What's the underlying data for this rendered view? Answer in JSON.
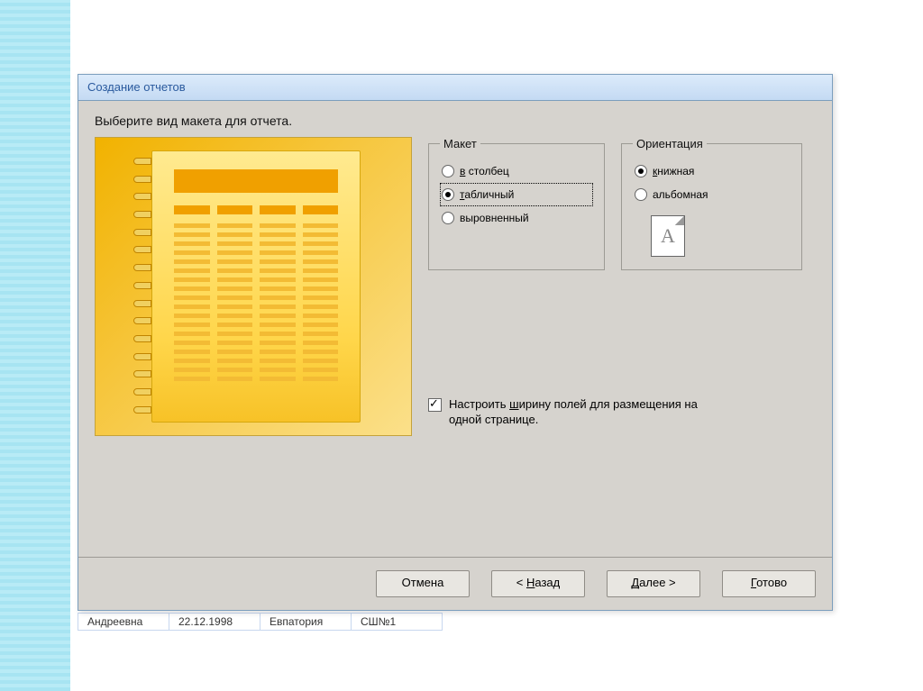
{
  "bg_cells": [
    "Андреевна",
    "22.12.1998",
    "Евпатория",
    "СШ№1"
  ],
  "dialog": {
    "title": "Создание отчетов",
    "instruction": "Выберите вид макета для отчета.",
    "layout_group": {
      "legend": "Макет",
      "options": [
        {
          "label": "в столбец",
          "underline": "в",
          "checked": false
        },
        {
          "label": "табличный",
          "underline": "т",
          "checked": true,
          "focused": true
        },
        {
          "label": "выровненный",
          "underline": "",
          "checked": false
        }
      ]
    },
    "orient_group": {
      "legend": "Ориентация",
      "options": [
        {
          "label": "книжная",
          "underline": "к",
          "checked": true
        },
        {
          "label": "альбомная",
          "underline": "",
          "checked": false
        }
      ],
      "page_letter": "A"
    },
    "fit_checkbox": {
      "checked": true,
      "underline": "ш",
      "label": "Настроить ширину полей для размещения на одной странице."
    },
    "buttons": {
      "cancel": "Отмена",
      "back": {
        "text": "< Назад",
        "underline": "Н"
      },
      "next": {
        "text": "Далее >",
        "underline": "Д"
      },
      "finish": {
        "text": "Готово",
        "underline": "Г"
      }
    }
  }
}
